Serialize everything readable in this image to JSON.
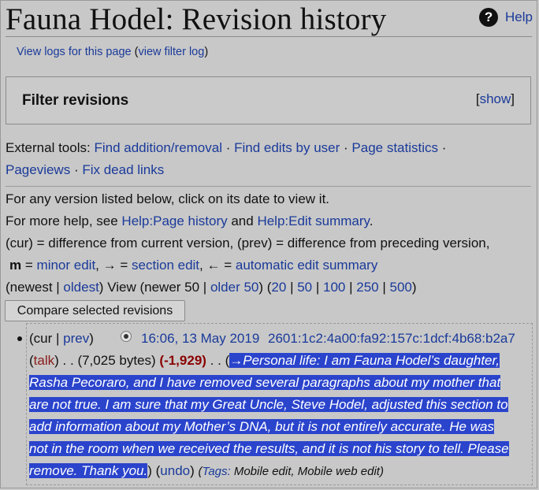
{
  "title": "Fauna Hodel: Revision history",
  "help": "Help",
  "logs": {
    "view_logs": "View logs for this page",
    "filter_log": "view filter log"
  },
  "filter": {
    "title": "Filter revisions",
    "show": "show"
  },
  "external_tools": {
    "label": "External tools:",
    "links": [
      "Find addition/removal",
      "Find edits by user",
      "Page statistics",
      "Pageviews",
      "Fix dead links"
    ]
  },
  "help_text": {
    "line1": "For any version listed below, click on its date to view it.",
    "line2_prefix": "For more help, see",
    "page_history": "Help:Page history",
    "and": "and",
    "edit_summary": "Help:Edit summary",
    "cur_def": "(cur) = difference from current version, (prev) = difference from preceding version,",
    "m": "m",
    "minor_prefix": "=",
    "minor_edit": "minor edit",
    "arrow_right": "→ =",
    "section_edit": "section edit",
    "arrow_left": "← =",
    "auto_summary": "automatic edit summary"
  },
  "nav": {
    "newest": "newest",
    "oldest": "oldest",
    "view": "View (newer 50 |",
    "older": "older 50",
    "counts": [
      "20",
      "50",
      "100",
      "250",
      "500"
    ]
  },
  "compare_button": "Compare selected revisions",
  "revision": {
    "cur": "cur",
    "prev": "prev",
    "date": "16:06, 13 May 2019",
    "user": "2601:1c2:4a00:fa92:157c:1dcf:4b68:b2a7",
    "talk": "talk",
    "bytes": ". . (7,025 bytes)",
    "change": "(-1,929)",
    "dots": ". . (",
    "summary_lines": [
      "→Personal life: I am Fauna Hodel’s daughter,",
      "Rasha Pecoraro, and I have removed several paragraphs about my mother that",
      "are not true. I am sure that my Great Uncle, Steve Hodel, adjusted this section to",
      "add information about my Mother’s DNA, but it is not entirely accurate. He was",
      "not in the room when we received the results, and it is not his story to tell. Please",
      "remove. Thank you."
    ],
    "undo": "undo",
    "tags_label": "Tags:",
    "tags": "Mobile edit, Mobile web edit"
  }
}
